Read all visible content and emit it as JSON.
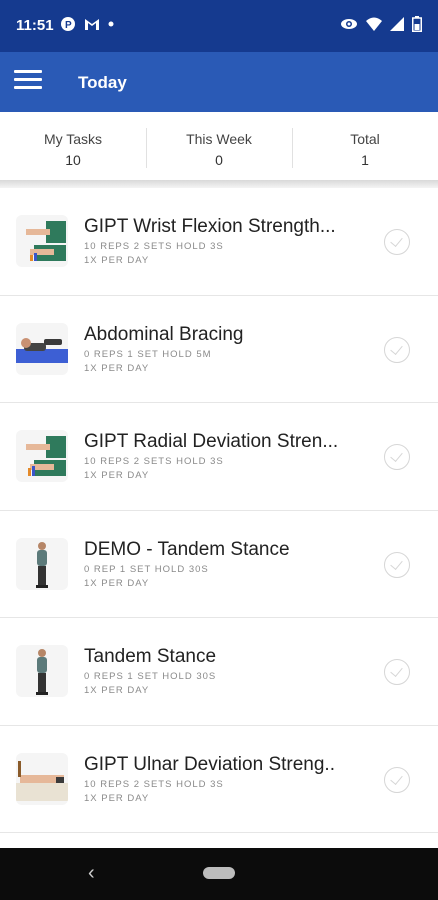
{
  "status_bar": {
    "time": "11:51"
  },
  "header": {
    "title": "Today"
  },
  "stats": [
    {
      "label": "My Tasks",
      "value": "10"
    },
    {
      "label": "This Week",
      "value": "0"
    },
    {
      "label": "Total",
      "value": "1"
    }
  ],
  "tasks": [
    {
      "title": "GIPT Wrist Flexion Strength...",
      "meta": "10 REPS   2 SETS   HOLD 3s",
      "frequency": "1x PER DAY",
      "icon": "wrist-flexion-icon"
    },
    {
      "title": "Abdominal Bracing",
      "meta": "0 REPS   1 SET   HOLD 5m",
      "frequency": "1x PER DAY",
      "icon": "abdominal-bracing-icon"
    },
    {
      "title": "GIPT Radial Deviation Stren...",
      "meta": "10 REPS   2 SETS   HOLD 3s",
      "frequency": "1x PER DAY",
      "icon": "radial-deviation-icon"
    },
    {
      "title": "DEMO - Tandem Stance",
      "meta": "0 REP   1 SET   HOLD 30s",
      "frequency": "1x PER DAY",
      "icon": "tandem-stance-icon"
    },
    {
      "title": "Tandem Stance",
      "meta": "0 REPS   1 SET   HOLD 30s",
      "frequency": "1x PER DAY",
      "icon": "tandem-stance-icon"
    },
    {
      "title": "GIPT Ulnar Deviation Streng..",
      "meta": "10 REPS   2 SETS   HOLD 3s",
      "frequency": "1x PER DAY",
      "icon": "ulnar-deviation-icon"
    }
  ],
  "colors": {
    "status_bar": "#153a8f",
    "app_bar": "#2a5ab6",
    "nav_bar": "#0c0c0c"
  }
}
